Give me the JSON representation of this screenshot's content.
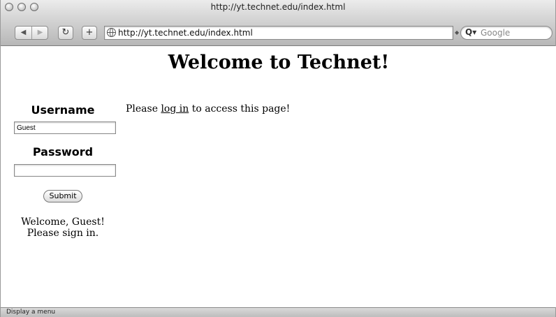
{
  "window": {
    "title": "http://yt.technet.edu/index.html"
  },
  "toolbar": {
    "back_icon": "◀",
    "forward_icon": "▶",
    "reload_icon": "↻",
    "add_icon": "+",
    "url": "http://yt.technet.edu/index.html",
    "search_placeholder": "Google",
    "search_icon": "Q▾"
  },
  "page": {
    "heading": "Welcome to Technet!",
    "sidebar": {
      "username_label": "Username",
      "username_value": "Guest",
      "password_label": "Password",
      "password_value": "",
      "submit_label": "Submit",
      "welcome_line1": "Welcome, Guest!",
      "welcome_line2": "Please sign in."
    },
    "main": {
      "prefix": "Please ",
      "link": "log in",
      "suffix": " to access this page!"
    }
  },
  "status": {
    "text": "Display a menu"
  }
}
